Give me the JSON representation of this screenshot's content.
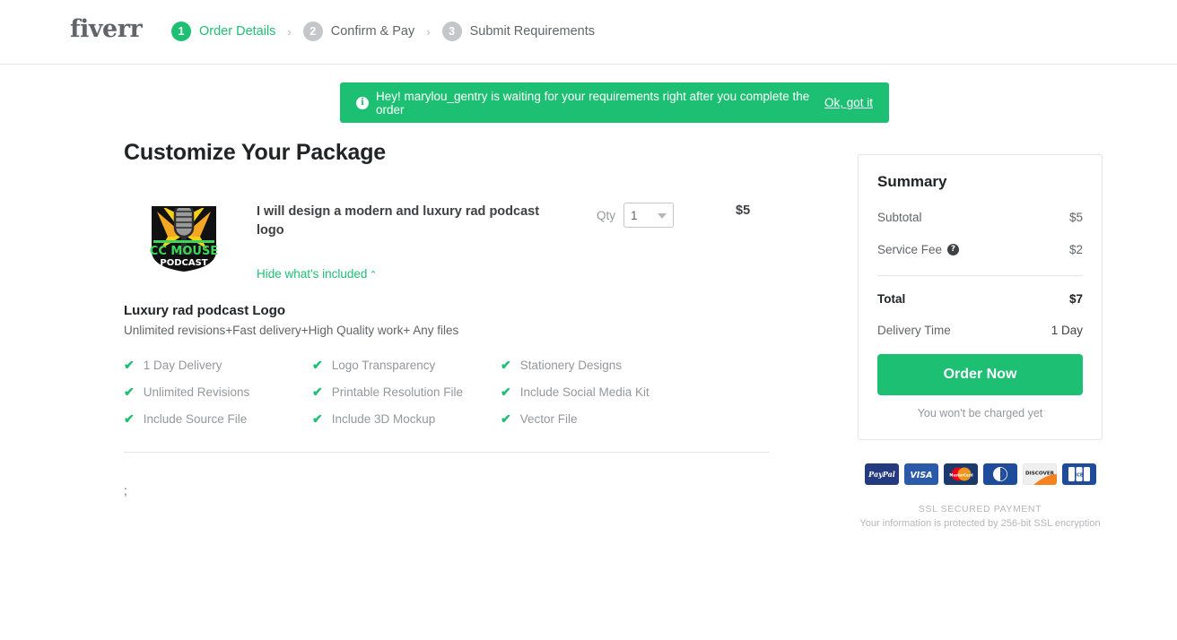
{
  "brand": {
    "logo_text": "fiverr",
    "accent_green": "#1dbf73",
    "dark": "#404145"
  },
  "header": {
    "steps": [
      {
        "num": "1",
        "label": "Order Details",
        "state": "active"
      },
      {
        "num": "2",
        "label": "Confirm & Pay",
        "state": "inactive"
      },
      {
        "num": "3",
        "label": "Submit Requirements",
        "state": "inactive"
      }
    ],
    "separator": "›"
  },
  "banner": {
    "icon": "info-icon",
    "icon_glyph": "i",
    "text": "Hey! marylou_gentry is waiting for your requirements right after you complete the order",
    "action_label": "Ok, got it",
    "background": "#1dbf73"
  },
  "main": {
    "page_title": "Customize Your Package",
    "gig": {
      "title": "I will design a modern and luxury rad podcast logo",
      "thumbnail_alt": "CC MOUSE PODCAST logo",
      "thumbnail_text_top": "CC MOUSE",
      "thumbnail_text_bottom": "PODCAST",
      "qty_label": "Qty",
      "qty_value": "1",
      "price": "$5",
      "toggle_label": "Hide what's included",
      "toggle_chevron": "⌃"
    },
    "package": {
      "name": "Luxury rad podcast Logo",
      "description": "Unlimited revisions+Fast delivery+High Quality work+ Any files",
      "features": [
        "1 Day Delivery",
        "Logo Transparency",
        "Stationery Designs",
        "Unlimited Revisions",
        "Printable Resolution File",
        "Include Social Media Kit",
        "Include Source File",
        "Include 3D Mockup",
        "Vector File"
      ],
      "check_glyph": "✔"
    },
    "stray_text": ";"
  },
  "sidebar": {
    "summary_title": "Summary",
    "rows": [
      {
        "label": "Subtotal",
        "value": "$5",
        "help": false
      },
      {
        "label": "Service Fee",
        "value": "$2",
        "help": true
      }
    ],
    "help_glyph": "?",
    "total": {
      "label": "Total",
      "value": "$7"
    },
    "delivery": {
      "label": "Delivery Time",
      "value": "1 Day"
    },
    "order_button": "Order Now",
    "charge_note": "You won't be charged yet",
    "payment_methods": [
      "PayPal",
      "VISA",
      "Mastercard",
      "Diners Club",
      "Discover",
      "JCB"
    ],
    "ssl_title": "SSL SECURED PAYMENT",
    "ssl_subtitle": "Your information is protected by 256-bit SSL encryption"
  }
}
